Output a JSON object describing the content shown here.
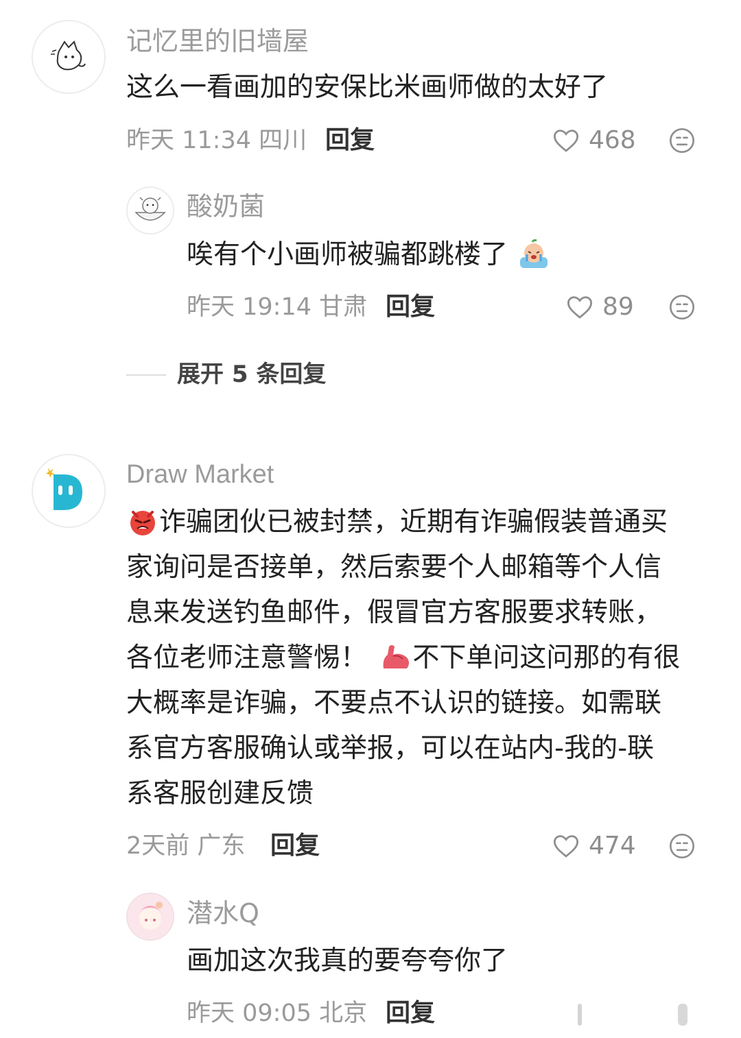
{
  "comments": [
    {
      "username": "记忆里的旧墙屋",
      "text": "这么一看画加的安保比米画师做的太好了",
      "time_location": "昨天 11:34 四川",
      "reply_label": "回复",
      "likes": "468",
      "replies": [
        {
          "username": "酸奶菌",
          "text": "唉有个小画师被骗都跳楼了",
          "time_location": "昨天 19:14 甘肃",
          "reply_label": "回复",
          "likes": "89"
        }
      ],
      "expand_label": "展开 5 条回复"
    },
    {
      "username": "Draw Market",
      "lines": [
        "诈骗团伙已被封禁，近期有诈骗假装普通买",
        "家询问是否接单，然后索要个人邮箱等个人信",
        "息来发送钓鱼邮件，假冒官方客服要求转账，",
        "各位老师注意警惕！",
        "不下单问这问那的有很",
        "大概率是诈骗，不要点不认识的链接。如需联",
        "系官方客服确认或举报，可以在站内-我的-联",
        "系客服创建反馈"
      ],
      "time_location": "2天前 广东",
      "reply_label": "回复",
      "likes": "474",
      "replies": [
        {
          "username": "潜水Q",
          "text": "画加这次我真的要夸夸你了",
          "time_location": "昨天 09:05 北京",
          "reply_label": "回复"
        }
      ]
    }
  ],
  "colors": {
    "brand_teal": "#28b7d3",
    "muted_text": "#9a9a9a",
    "emoji_red": "#e8453c",
    "emoji_pink": "#e85a6a"
  },
  "icons": [
    "heart-icon",
    "dislike-face-icon",
    "angry-face-emoji",
    "muscle-emoji",
    "crying-face-emoji"
  ]
}
